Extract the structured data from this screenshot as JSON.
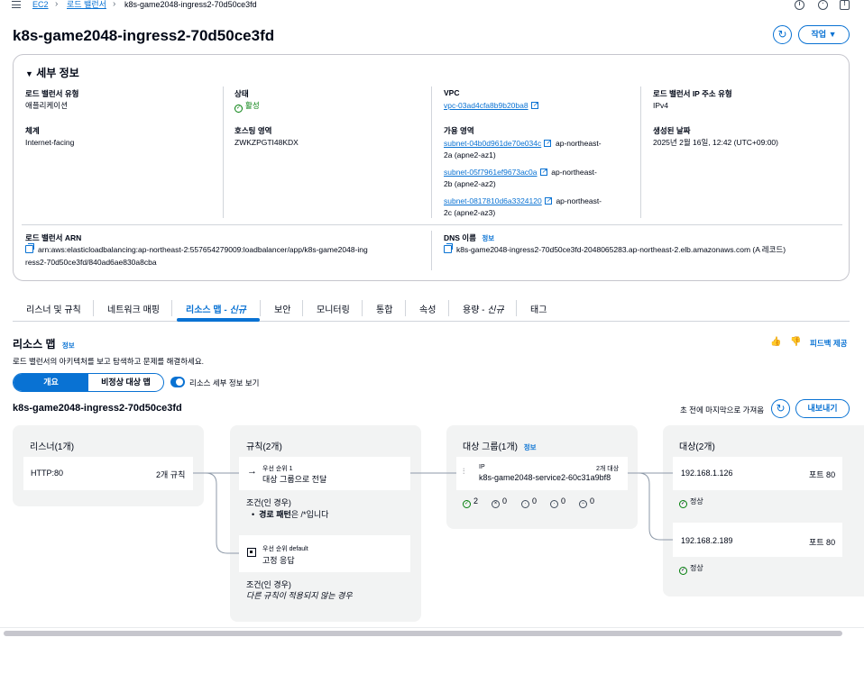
{
  "breadcrumb": {
    "ec2": "EC2",
    "lb": "로드 밸런서",
    "current": "k8s-game2048-ingress2-70d50ce3fd"
  },
  "title": "k8s-game2048-ingress2-70d50ce3fd",
  "actions_label": "작업",
  "details": {
    "heading": "세부 정보",
    "lb_type_label": "로드 밸런서 유형",
    "lb_type_value": "애플리케이션",
    "status_label": "상태",
    "status_value": "활성",
    "vpc_label": "VPC",
    "vpc_value": "vpc-03ad4cfa8b9b20ba8",
    "ip_type_label": "로드 밸런서 IP 주소 유형",
    "ip_type_value": "IPv4",
    "scheme_label": "체계",
    "scheme_value": "Internet-facing",
    "hosted_zone_label": "호스팅 영역",
    "hosted_zone_value": "ZWKZPGTI48KDX",
    "az_label": "가용 영역",
    "subnets": [
      {
        "id": "subnet-04b0d961de70e034c",
        "zone1": "ap-northeast-",
        "zone2": "2a (apne2-az1)"
      },
      {
        "id": "subnet-05f7961ef9673ac0a",
        "zone1": "ap-northeast-",
        "zone2": "2b (apne2-az2)"
      },
      {
        "id": "subnet-0817810d6a3324120",
        "zone1": "ap-northeast-",
        "zone2": "2c (apne2-az3)"
      }
    ],
    "created_label": "생성된 날짜",
    "created_value": "2025년 2월 16일, 12:42 (UTC+09:00)",
    "arn_label": "로드 밸런서 ARN",
    "arn_line1": "arn:aws:elasticloadbalancing:ap-northeast-2:557654279009:loadbalancer/app/k8s-game2048-ing",
    "arn_line2": "ress2-70d50ce3fd/840ad6ae830a8cba",
    "dns_label": "DNS 이름",
    "dns_info": "정보",
    "dns_value": "k8s-game2048-ingress2-70d50ce3fd-2048065283.ap-northeast-2.elb.amazonaws.com (A 레코드)"
  },
  "tabs": [
    {
      "label": "리스너 및 규칙"
    },
    {
      "label": "네트워크 매핑"
    },
    {
      "label": "리소스 맵 - 신규"
    },
    {
      "label": "보안"
    },
    {
      "label": "모니터링"
    },
    {
      "label": "통합"
    },
    {
      "label": "속성"
    },
    {
      "label": "용량 - 신규"
    },
    {
      "label": "태그"
    }
  ],
  "resource_map": {
    "title": "리소스 맵",
    "info": "정보",
    "description": "로드 밸런서의 아키텍처를 보고 탐색하고 문제를 해결하세요.",
    "feedback": "피드백 제공",
    "seg_overview": "개요",
    "seg_unhealthy": "비정상 대상 맵",
    "toggle_label": "리소스 세부 정보 보기",
    "lb_name": "k8s-game2048-ingress2-70d50ce3fd",
    "fetched": "초 전에 마지막으로 가져옴",
    "export": "내보내기",
    "listeners_title": "리스너(1개)",
    "listener_name": "HTTP:80",
    "listener_rules": "2개 규칙",
    "rules_title": "규칙(2개)",
    "rule1_priority": "우선 순위 1",
    "rule1_action": "대상 그룹으로 전달",
    "rule1_cond_label": "조건(인 경우)",
    "rule1_cond_key": "경로 패턴",
    "rule1_cond_rest": "은 /*입니다",
    "rule2_priority": "우선 순위 default",
    "rule2_action": "고정 응답",
    "rule2_cond_label": "조건(인 경우)",
    "rule2_cond_value": "다른 규칙이 적용되지 않는 경우",
    "tg_title": "대상 그룹(1개)",
    "tg_info": "정보",
    "tg_type": "IP",
    "tg_count": "2개 대상",
    "tg_name": "k8s-game2048-service2-60c31a9bf8",
    "tg_stats": [
      "2",
      "0",
      "0",
      "0",
      "0"
    ],
    "targets_title": "대상(2개)",
    "targets": [
      {
        "ip": "192.168.1.126",
        "port": "포트 80",
        "status": "정상"
      },
      {
        "ip": "192.168.2.189",
        "port": "포트 80",
        "status": "정상"
      }
    ]
  }
}
